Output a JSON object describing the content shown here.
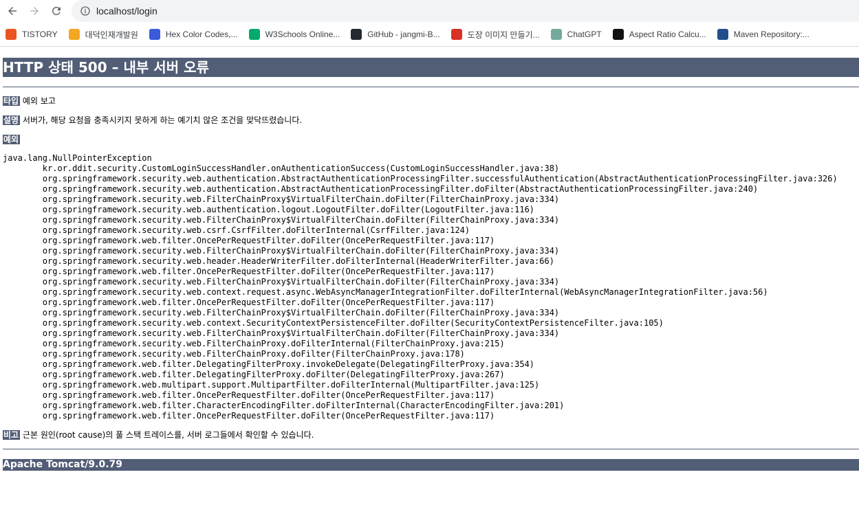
{
  "browser": {
    "url": "localhost/login",
    "bookmarks": [
      {
        "label": "TISTORY",
        "icon": "tistory-icon",
        "color": "#eb531f"
      },
      {
        "label": "대덕인재개발원",
        "icon": "ddit-icon",
        "color": "#f5a623"
      },
      {
        "label": "Hex Color Codes,...",
        "icon": "hexcolor-icon",
        "color": "#3b5bdb"
      },
      {
        "label": "W3Schools Online...",
        "icon": "w3schools-icon",
        "color": "#04aa6d"
      },
      {
        "label": "GitHub - jangmi-B...",
        "icon": "github-icon",
        "color": "#24292f"
      },
      {
        "label": "도장 이미지 만들기...",
        "icon": "stamp-icon",
        "color": "#d93025"
      },
      {
        "label": "ChatGPT",
        "icon": "chatgpt-icon",
        "color": "#74aa9c"
      },
      {
        "label": "Aspect Ratio Calcu...",
        "icon": "aspect-ratio-icon",
        "color": "#111111"
      },
      {
        "label": "Maven Repository:...",
        "icon": "maven-icon",
        "color": "#1f4e8c"
      }
    ]
  },
  "error": {
    "title": "HTTP 상태 500 – 내부 서버 오류",
    "type_label": "타입",
    "type_value": "예외 보고",
    "desc_label": "설명",
    "desc_value": "서버가, 해당 요청을 충족시키지 못하게 하는 예기치 않은 조건을 맞닥뜨렸습니다.",
    "exception_label": "예외",
    "exception": "java.lang.NullPointerException",
    "stack": [
      "kr.or.ddit.security.CustomLoginSuccessHandler.onAuthenticationSuccess(CustomLoginSuccessHandler.java:38)",
      "org.springframework.security.web.authentication.AbstractAuthenticationProcessingFilter.successfulAuthentication(AbstractAuthenticationProcessingFilter.java:326)",
      "org.springframework.security.web.authentication.AbstractAuthenticationProcessingFilter.doFilter(AbstractAuthenticationProcessingFilter.java:240)",
      "org.springframework.security.web.FilterChainProxy$VirtualFilterChain.doFilter(FilterChainProxy.java:334)",
      "org.springframework.security.web.authentication.logout.LogoutFilter.doFilter(LogoutFilter.java:116)",
      "org.springframework.security.web.FilterChainProxy$VirtualFilterChain.doFilter(FilterChainProxy.java:334)",
      "org.springframework.security.web.csrf.CsrfFilter.doFilterInternal(CsrfFilter.java:124)",
      "org.springframework.web.filter.OncePerRequestFilter.doFilter(OncePerRequestFilter.java:117)",
      "org.springframework.security.web.FilterChainProxy$VirtualFilterChain.doFilter(FilterChainProxy.java:334)",
      "org.springframework.security.web.header.HeaderWriterFilter.doFilterInternal(HeaderWriterFilter.java:66)",
      "org.springframework.web.filter.OncePerRequestFilter.doFilter(OncePerRequestFilter.java:117)",
      "org.springframework.security.web.FilterChainProxy$VirtualFilterChain.doFilter(FilterChainProxy.java:334)",
      "org.springframework.security.web.context.request.async.WebAsyncManagerIntegrationFilter.doFilterInternal(WebAsyncManagerIntegrationFilter.java:56)",
      "org.springframework.web.filter.OncePerRequestFilter.doFilter(OncePerRequestFilter.java:117)",
      "org.springframework.security.web.FilterChainProxy$VirtualFilterChain.doFilter(FilterChainProxy.java:334)",
      "org.springframework.security.web.context.SecurityContextPersistenceFilter.doFilter(SecurityContextPersistenceFilter.java:105)",
      "org.springframework.security.web.FilterChainProxy$VirtualFilterChain.doFilter(FilterChainProxy.java:334)",
      "org.springframework.security.web.FilterChainProxy.doFilterInternal(FilterChainProxy.java:215)",
      "org.springframework.security.web.FilterChainProxy.doFilter(FilterChainProxy.java:178)",
      "org.springframework.web.filter.DelegatingFilterProxy.invokeDelegate(DelegatingFilterProxy.java:354)",
      "org.springframework.web.filter.DelegatingFilterProxy.doFilter(DelegatingFilterProxy.java:267)",
      "org.springframework.web.multipart.support.MultipartFilter.doFilterInternal(MultipartFilter.java:125)",
      "org.springframework.web.filter.OncePerRequestFilter.doFilter(OncePerRequestFilter.java:117)",
      "org.springframework.web.filter.CharacterEncodingFilter.doFilterInternal(CharacterEncodingFilter.java:201)",
      "org.springframework.web.filter.OncePerRequestFilter.doFilter(OncePerRequestFilter.java:117)"
    ],
    "note_label": "비고",
    "note_value": "근본 원인(root cause)의 풀 스택 트레이스를, 서버 로그들에서 확인할 수 있습니다.",
    "server": "Apache Tomcat/9.0.79"
  },
  "colors": {
    "header_bg": "#525d76",
    "omnibox_bg": "#f1f3f4"
  }
}
